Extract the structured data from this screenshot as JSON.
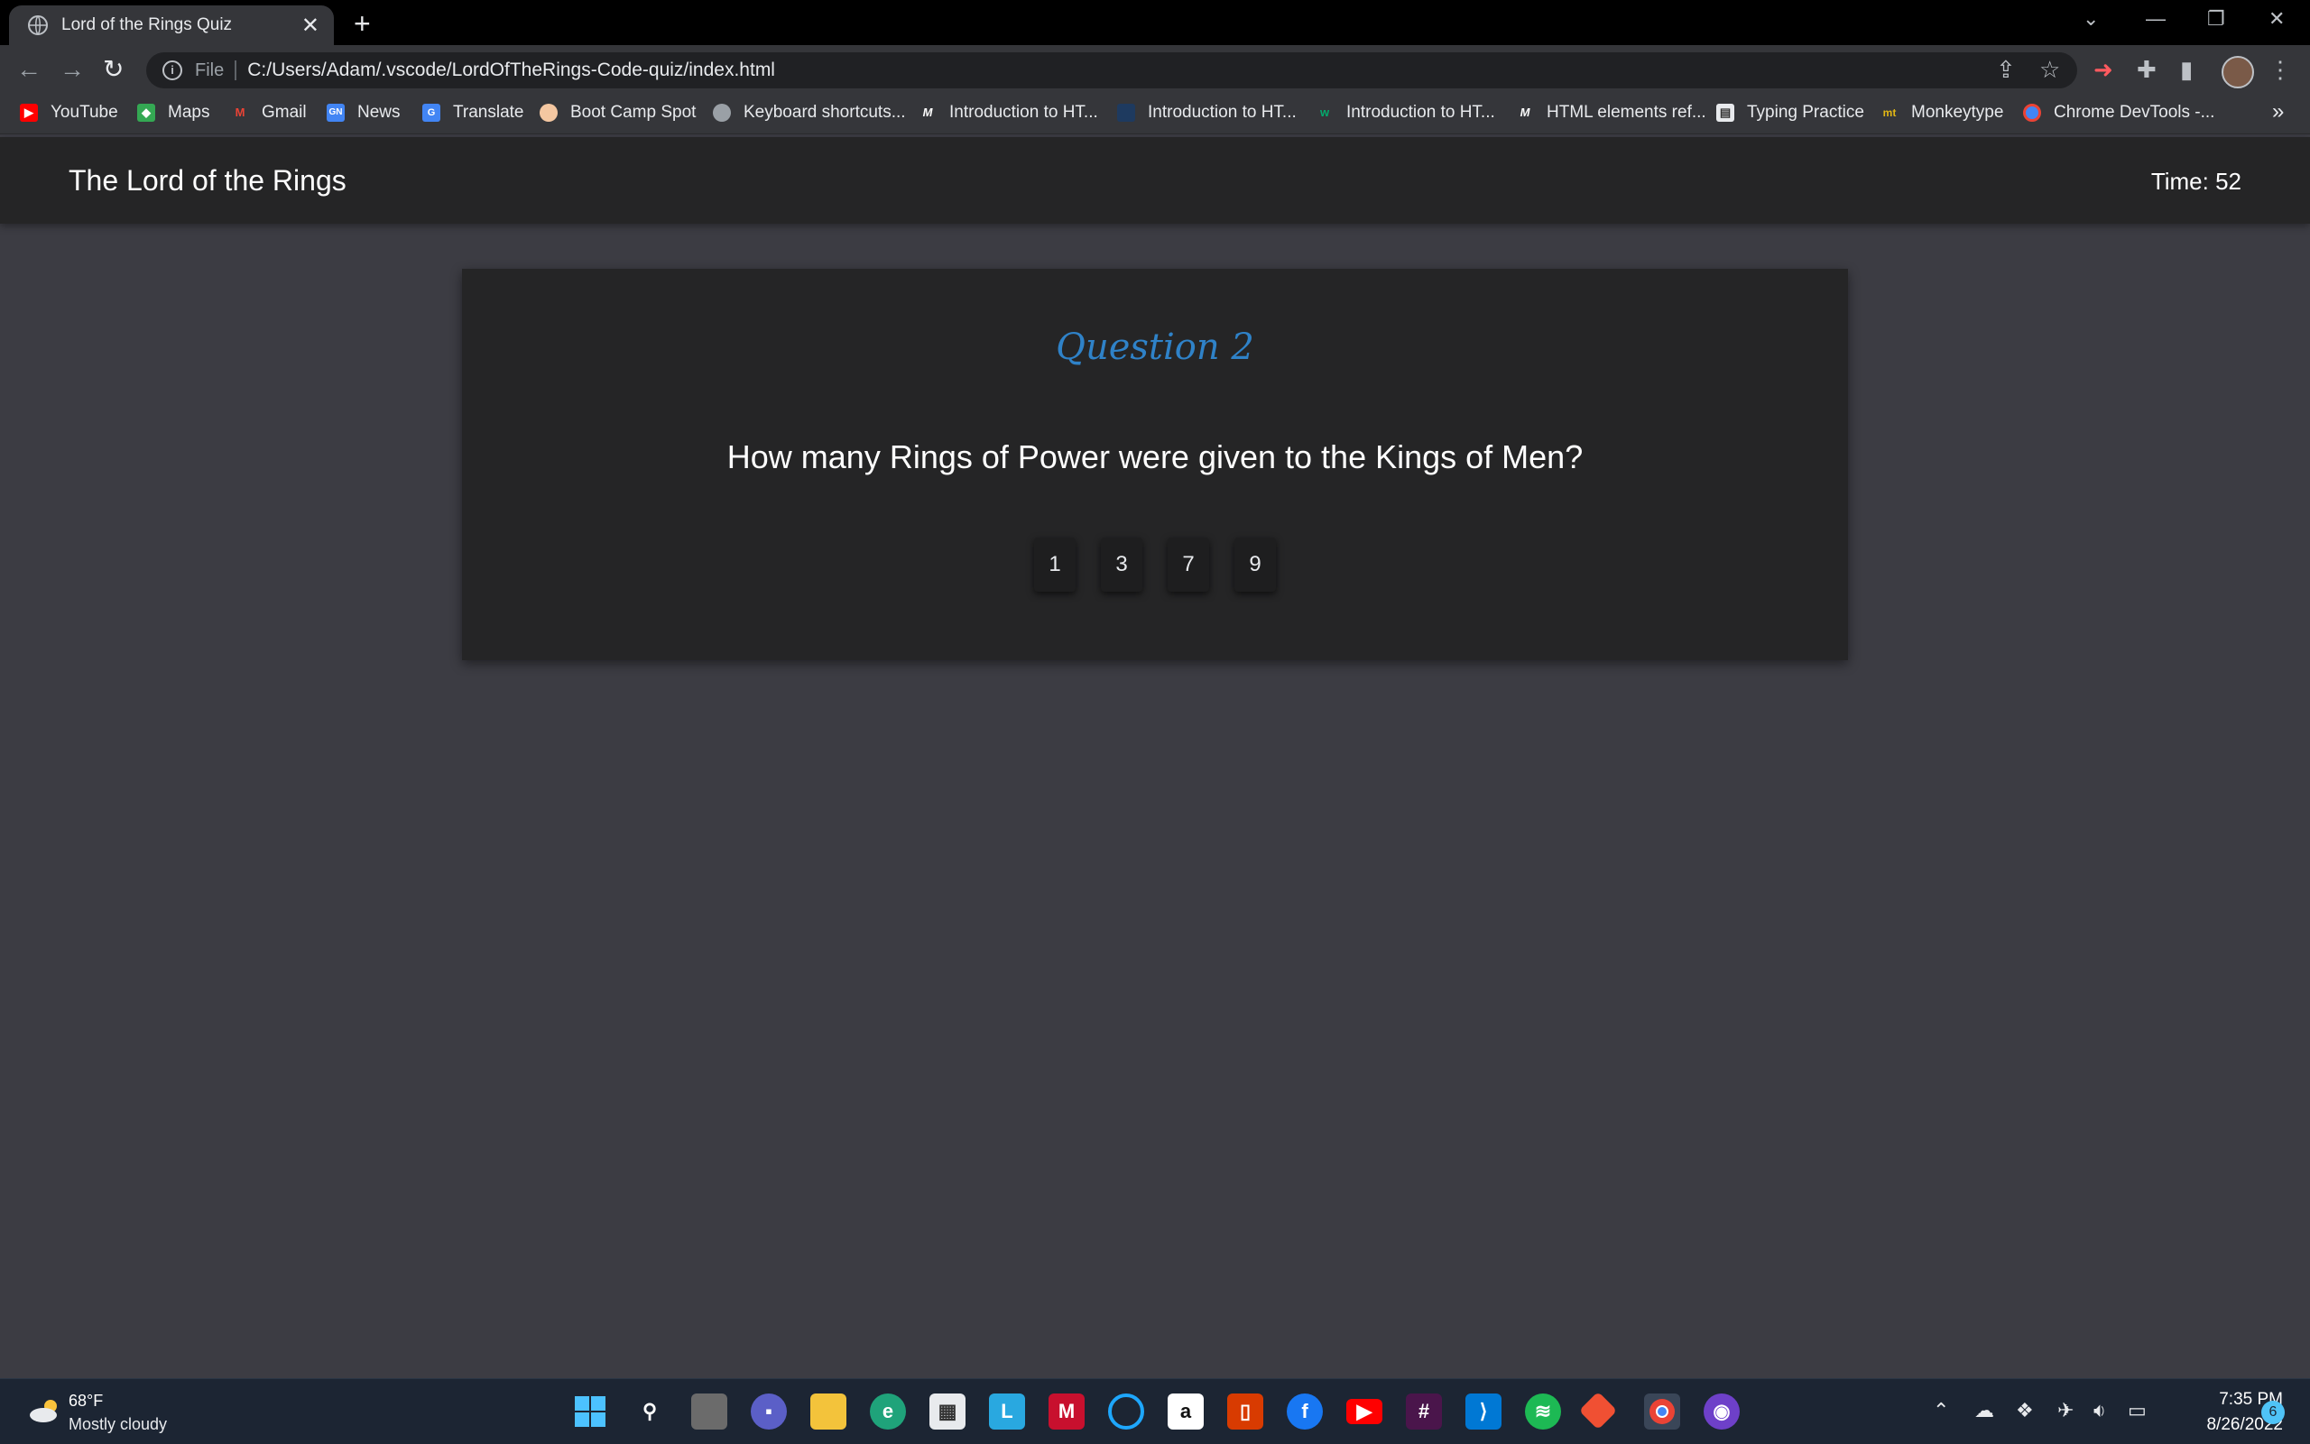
{
  "browser": {
    "tab_title": "Lord of the Rings Quiz",
    "new_tab": "+",
    "omnibox": {
      "scheme": "File",
      "url": "C:/Users/Adam/.vscode/LordOfTheRings-Code-quiz/index.html"
    },
    "bookmarks": [
      {
        "label": "YouTube",
        "icon": "youtube-icon",
        "color": "#ff0000"
      },
      {
        "label": "Maps",
        "icon": "maps-icon",
        "color": "#34a853"
      },
      {
        "label": "Gmail",
        "icon": "gmail-icon",
        "color": "#ea4335"
      },
      {
        "label": "News",
        "icon": "news-icon",
        "color": "#4285f4"
      },
      {
        "label": "Translate",
        "icon": "translate-icon",
        "color": "#4285f4"
      },
      {
        "label": "Boot Camp Spot",
        "icon": "bootcamp-icon",
        "color": "#f4c7a1"
      },
      {
        "label": "Keyboard shortcuts...",
        "icon": "globe-icon",
        "color": "#9aa0a6"
      },
      {
        "label": "Introduction to HT...",
        "icon": "mdn-icon",
        "color": "#000000"
      },
      {
        "label": "Introduction to HT...",
        "icon": "page-icon",
        "color": "#1a73e8"
      },
      {
        "label": "Introduction to HT...",
        "icon": "w-icon",
        "color": "#04aa6d"
      },
      {
        "label": "HTML elements ref...",
        "icon": "mdn-icon",
        "color": "#000000"
      },
      {
        "label": "Typing Practice",
        "icon": "typing-icon",
        "color": "#e8eaed"
      },
      {
        "label": "Monkeytype",
        "icon": "monkeytype-icon",
        "color": "#e2b714"
      },
      {
        "label": "Chrome DevTools -...",
        "icon": "chrome-icon",
        "color": "#4285f4"
      }
    ],
    "bookmarks_more": "»"
  },
  "page": {
    "site_title": "The Lord of the Rings",
    "timer_label": "Time: 52",
    "question_number": "Question 2",
    "question_text": "How many Rings of Power were given to the Kings of Men?",
    "answers": [
      "1",
      "3",
      "7",
      "9"
    ],
    "accent_color": "#2f82c8"
  },
  "taskbar": {
    "weather_temp": "68°F",
    "weather_desc": "Mostly cloudy",
    "clock_time": "7:35 PM",
    "clock_date": "8/26/2022",
    "notifications": "6",
    "apps": [
      "windows-start-icon",
      "search-icon",
      "task-view-icon",
      "teams-chat-icon",
      "file-explorer-icon",
      "edge-icon",
      "store-icon",
      "l-app-icon",
      "mcafee-icon",
      "cortana-icon",
      "amazon-icon",
      "office-icon",
      "facebook-icon",
      "youtube-icon",
      "slack-icon",
      "vscode-icon",
      "spotify-icon",
      "git-icon",
      "chrome-icon",
      "github-icon"
    ]
  }
}
